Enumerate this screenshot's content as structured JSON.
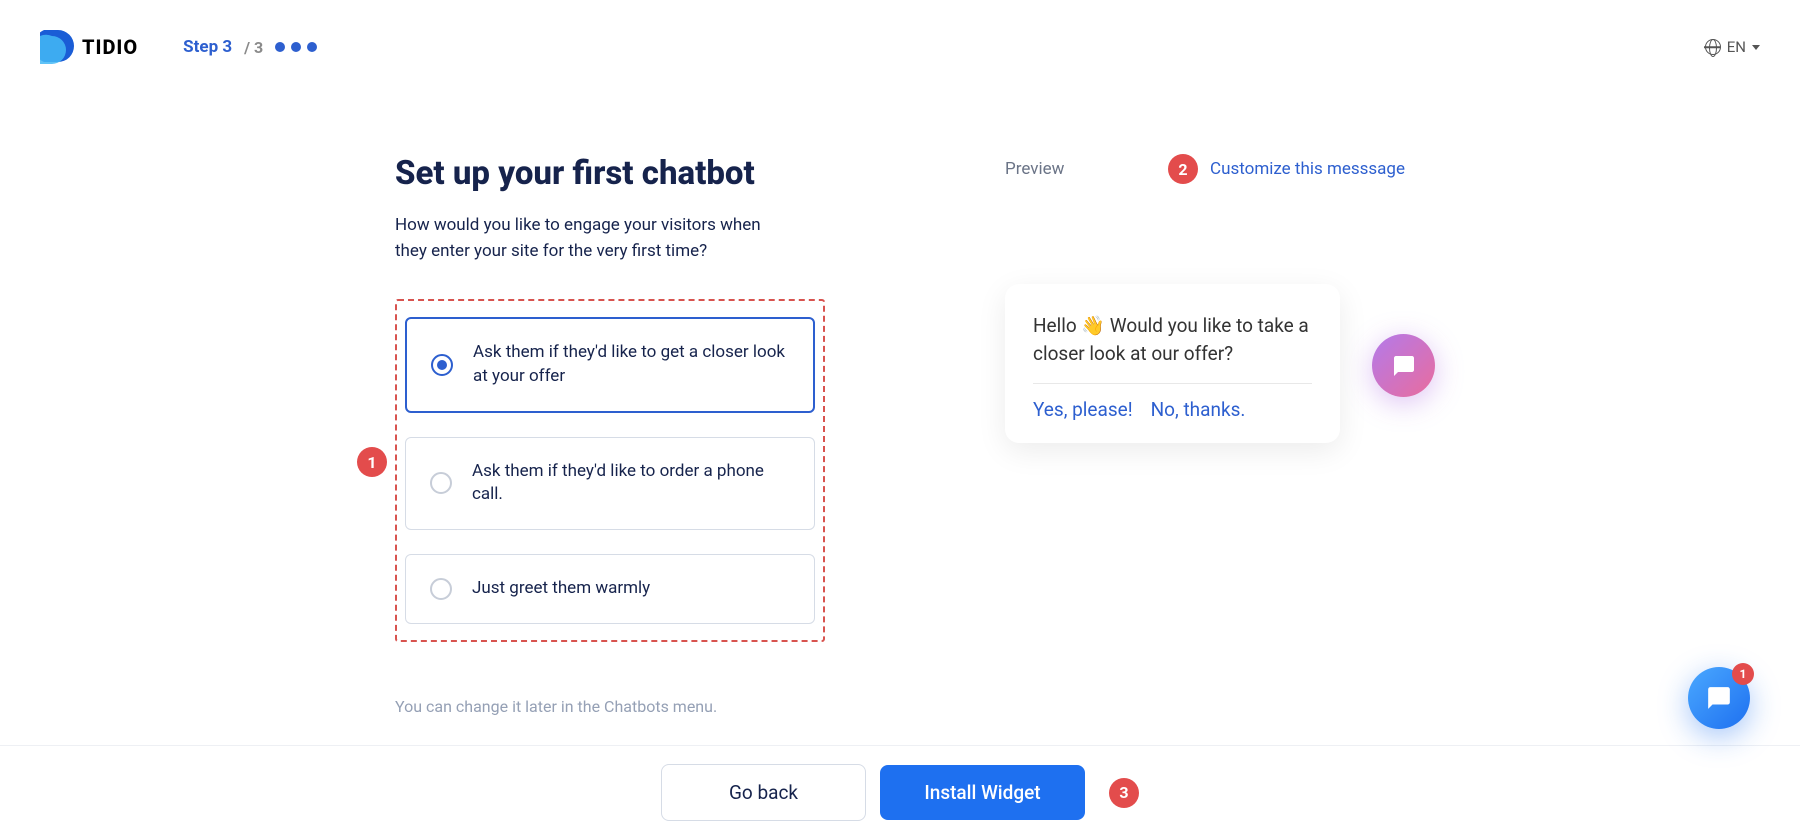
{
  "brand": "TIDIO",
  "header": {
    "step_label": "Step 3",
    "step_total": "/ 3",
    "lang": "EN"
  },
  "page": {
    "title": "Set up your first chatbot",
    "subtitle": "How would you like to engage your visitors when they enter your site for the very first time?",
    "helper": "You can change it later in the Chatbots menu."
  },
  "options": [
    {
      "label": "Ask them if they'd like to get a closer look at your offer",
      "selected": true
    },
    {
      "label": "Ask them if they'd like to order a phone call.",
      "selected": false
    },
    {
      "label": "Just greet them warmly",
      "selected": false
    }
  ],
  "preview": {
    "label": "Preview",
    "customize": "Customize this messsage",
    "message": "Hello 👋 Would you like to take a closer look at our offer?",
    "actions": {
      "yes": "Yes, please!",
      "no": "No, thanks."
    }
  },
  "footer": {
    "back": "Go back",
    "install": "Install Widget"
  },
  "annotations": {
    "a1": "1",
    "a2": "2",
    "a3": "3"
  },
  "floating_badge": "1"
}
